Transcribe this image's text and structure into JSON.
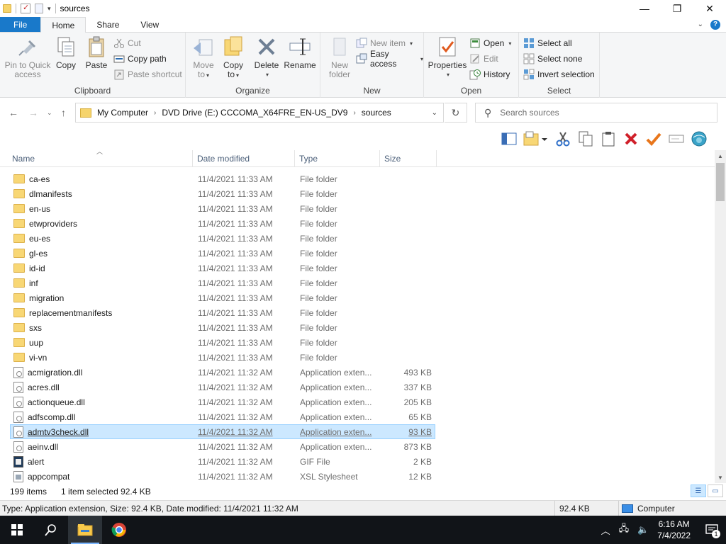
{
  "window": {
    "title": "sources",
    "controls": {
      "minimize": "—",
      "maximize": "❐",
      "close": "✕"
    }
  },
  "ribbon_tabs": [
    {
      "label": "File"
    },
    {
      "label": "Home"
    },
    {
      "label": "Share"
    },
    {
      "label": "View"
    }
  ],
  "ribbon": {
    "clipboard": {
      "label": "Clipboard",
      "pin": "Pin to Quick access",
      "pin_l1": "Pin to Quick",
      "pin_l2": "access",
      "copy": "Copy",
      "paste": "Paste",
      "cut": "Cut",
      "copy_path": "Copy path",
      "paste_shortcut": "Paste shortcut"
    },
    "organize": {
      "label": "Organize",
      "move_l1": "Move",
      "move_l2": "to",
      "copy_l1": "Copy",
      "copy_l2": "to",
      "delete": "Delete",
      "rename": "Rename"
    },
    "new": {
      "label": "New",
      "new_folder_l1": "New",
      "new_folder_l2": "folder",
      "new_item": "New item",
      "easy_access": "Easy access"
    },
    "open": {
      "label": "Open",
      "properties": "Properties",
      "open": "Open",
      "edit": "Edit",
      "history": "History"
    },
    "select": {
      "label": "Select",
      "select_all": "Select all",
      "select_none": "Select none",
      "invert": "Invert selection"
    }
  },
  "address": {
    "crumbs": [
      "My Computer",
      "DVD Drive (E:) CCCOMA_X64FRE_EN-US_DV9",
      "sources"
    ],
    "search_placeholder": "Search sources"
  },
  "columns": {
    "name": "Name",
    "date": "Date modified",
    "type": "Type",
    "size": "Size"
  },
  "files": [
    {
      "name": "ca-es",
      "date": "11/4/2021 11:33 AM",
      "type": "File folder",
      "size": "",
      "icon": "folder"
    },
    {
      "name": "dlmanifests",
      "date": "11/4/2021 11:33 AM",
      "type": "File folder",
      "size": "",
      "icon": "folder"
    },
    {
      "name": "en-us",
      "date": "11/4/2021 11:33 AM",
      "type": "File folder",
      "size": "",
      "icon": "folder"
    },
    {
      "name": "etwproviders",
      "date": "11/4/2021 11:33 AM",
      "type": "File folder",
      "size": "",
      "icon": "folder"
    },
    {
      "name": "eu-es",
      "date": "11/4/2021 11:33 AM",
      "type": "File folder",
      "size": "",
      "icon": "folder"
    },
    {
      "name": "gl-es",
      "date": "11/4/2021 11:33 AM",
      "type": "File folder",
      "size": "",
      "icon": "folder"
    },
    {
      "name": "id-id",
      "date": "11/4/2021 11:33 AM",
      "type": "File folder",
      "size": "",
      "icon": "folder"
    },
    {
      "name": "inf",
      "date": "11/4/2021 11:33 AM",
      "type": "File folder",
      "size": "",
      "icon": "folder"
    },
    {
      "name": "migration",
      "date": "11/4/2021 11:33 AM",
      "type": "File folder",
      "size": "",
      "icon": "folder"
    },
    {
      "name": "replacementmanifests",
      "date": "11/4/2021 11:33 AM",
      "type": "File folder",
      "size": "",
      "icon": "folder"
    },
    {
      "name": "sxs",
      "date": "11/4/2021 11:33 AM",
      "type": "File folder",
      "size": "",
      "icon": "folder"
    },
    {
      "name": "uup",
      "date": "11/4/2021 11:33 AM",
      "type": "File folder",
      "size": "",
      "icon": "folder"
    },
    {
      "name": "vi-vn",
      "date": "11/4/2021 11:33 AM",
      "type": "File folder",
      "size": "",
      "icon": "folder"
    },
    {
      "name": "acmigration.dll",
      "date": "11/4/2021 11:32 AM",
      "type": "Application exten...",
      "size": "493 KB",
      "icon": "dll"
    },
    {
      "name": "acres.dll",
      "date": "11/4/2021 11:32 AM",
      "type": "Application exten...",
      "size": "337 KB",
      "icon": "dll"
    },
    {
      "name": "actionqueue.dll",
      "date": "11/4/2021 11:32 AM",
      "type": "Application exten...",
      "size": "205 KB",
      "icon": "dll"
    },
    {
      "name": "adfscomp.dll",
      "date": "11/4/2021 11:32 AM",
      "type": "Application exten...",
      "size": "65 KB",
      "icon": "dll"
    },
    {
      "name": "admtv3check.dll",
      "date": "11/4/2021 11:32 AM",
      "type": "Application exten...",
      "size": "93 KB",
      "icon": "dll",
      "selected": true
    },
    {
      "name": "aeinv.dll",
      "date": "11/4/2021 11:32 AM",
      "type": "Application exten...",
      "size": "873 KB",
      "icon": "dll"
    },
    {
      "name": "alert",
      "date": "11/4/2021 11:32 AM",
      "type": "GIF File",
      "size": "2 KB",
      "icon": "gif"
    },
    {
      "name": "appcompat",
      "date": "11/4/2021 11:32 AM",
      "type": "XSL Stylesheet",
      "size": "12 KB",
      "icon": "xsl"
    }
  ],
  "status": {
    "count": "199 items",
    "selected": "1 item selected  92.4 KB",
    "details": "Type: Application extension, Size: 92.4 KB, Date modified: 11/4/2021 11:32 AM",
    "size": "92.4 KB",
    "zone": "Computer"
  },
  "taskbar": {
    "time": "6:16 AM",
    "date": "7/4/2022",
    "notifications": "1"
  },
  "colors": {
    "file_tab": "#1979ca",
    "selection": "#cce8ff",
    "folder": "#f8d775"
  }
}
